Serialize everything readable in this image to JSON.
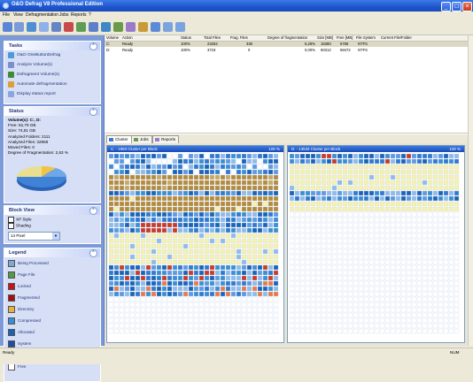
{
  "window": {
    "title": "O&O Defrag V8 Professional Edition",
    "minimize_glyph": "_",
    "maximize_glyph": "□",
    "close_glyph": "×"
  },
  "menu": {
    "items": [
      "File",
      "View",
      "Defragmentation",
      "Jobs",
      "Reports",
      "?"
    ]
  },
  "toolbar": {
    "icons": [
      "start-icon",
      "stop-icon",
      "pause-icon",
      "settings-icon",
      "volume-icon",
      "cancel-icon",
      "refresh-icon",
      "analyze-icon",
      "defrag-icon",
      "job-icon",
      "report-icon",
      "disk-icon",
      "zoom-icon",
      "back-icon",
      "forward-icon"
    ]
  },
  "tasks": {
    "header": "Tasks",
    "items": [
      {
        "label": "O&O OneButtonDefrag",
        "icon": "onebutton-icon",
        "color": "#4a9bd8"
      },
      {
        "label": "Analyze Volume(s)",
        "icon": "analyze-icon",
        "color": "#7a8fcf"
      },
      {
        "label": "Defragment Volume(s)",
        "icon": "defrag-icon",
        "color": "#3f8a3a"
      },
      {
        "label": "Automate defragmentation",
        "icon": "automate-icon",
        "color": "#d9a03a"
      },
      {
        "label": "Display status report",
        "icon": "report-icon",
        "color": "#8aa6e0"
      }
    ]
  },
  "status": {
    "header": "Status",
    "volume": "Volume(s): C:, D:",
    "lines": [
      "Free: 62,79 GB",
      "Size: 74,51 GB",
      "Analyzed Folders: 2111",
      "Analyzed Files: 32959",
      "Moved Files: 0",
      "Degree of Fragmentation: 2,63 %"
    ]
  },
  "blockview": {
    "header": "Block View",
    "xp_style": "XP Style",
    "shading": "Shading",
    "pixel_size": "14 Pixel"
  },
  "legend": {
    "header": "Legend",
    "items": [
      {
        "label": "Being Processed",
        "color": "#7fa7d8"
      },
      {
        "label": "Page File",
        "color": "#4f9a44"
      },
      {
        "label": "Locked",
        "color": "#c81414"
      },
      {
        "label": "Fragmented",
        "color": "#a50f0f"
      },
      {
        "label": "Directory",
        "color": "#e8b040"
      },
      {
        "label": "Compressed",
        "color": "#3a8fd4"
      },
      {
        "label": "Allocated",
        "color": "#1a64b8"
      },
      {
        "label": "System",
        "color": "#1d4fa8"
      },
      {
        "label": "Reserved for MFT",
        "color": "#f5f1b0"
      },
      {
        "label": "Free",
        "color": "#ffffff"
      }
    ]
  },
  "volumes_table": {
    "columns": [
      "Volume",
      "Action",
      "Status",
      "Total Files",
      "Frag. Files",
      "Degree of fragmentation",
      "Size [MB]",
      "Free [MB]",
      "File System",
      "Current File/Folder"
    ],
    "rows": [
      [
        "C:",
        "Ready",
        "100%",
        "23252",
        "336",
        "5,26%",
        "16380",
        "5768",
        "NTFS",
        ""
      ],
      [
        "D:",
        "Ready",
        "100%",
        "3718",
        "0",
        "0,00%",
        "60312",
        "58472",
        "NTFS",
        ""
      ]
    ]
  },
  "tabs": [
    "Cluster",
    "Jobs",
    "Reports"
  ],
  "disks": [
    {
      "title": "C: - 1993 Cluster per Block",
      "pct": "100 %"
    },
    {
      "title": "D: - 13533 Cluster per Block",
      "pct": "100 %"
    }
  ],
  "statusbar": {
    "left": "Ready",
    "right": "NUM"
  }
}
